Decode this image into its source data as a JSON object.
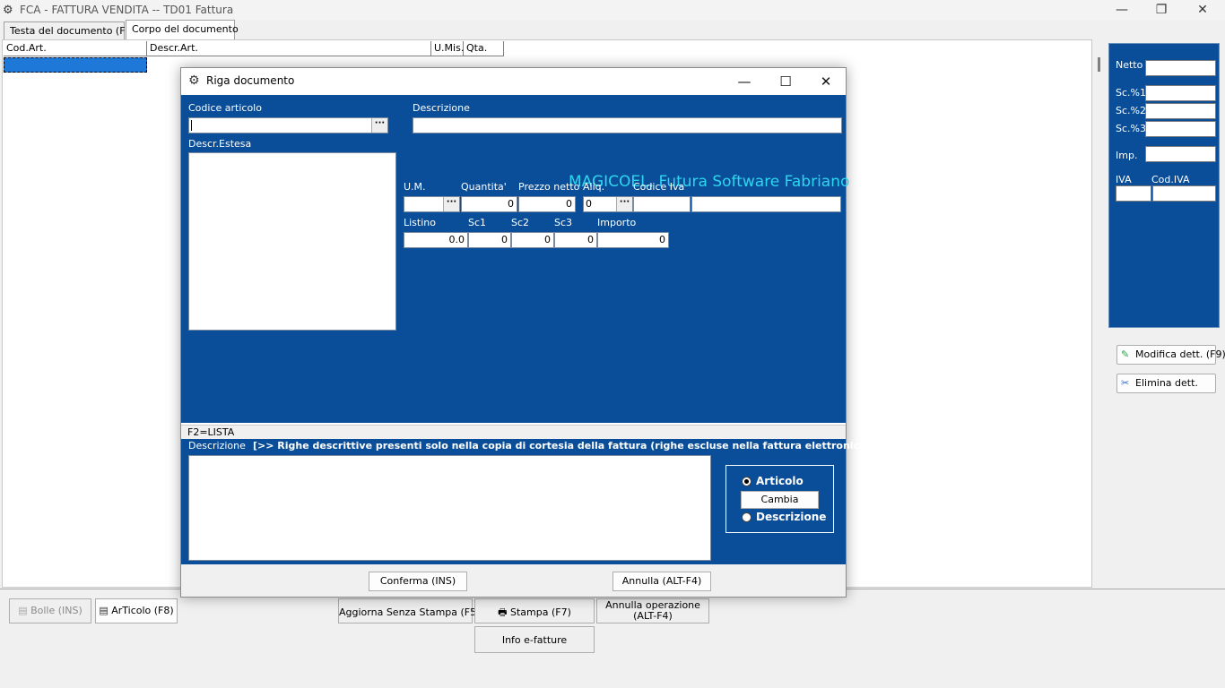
{
  "window": {
    "title": "FCA - FATTURA VENDITA  --  TD01 Fattura",
    "minimize": "—",
    "restore": "❐",
    "close": "✕"
  },
  "tabs": [
    {
      "label": "Testa del documento (F6)"
    },
    {
      "label": "Corpo del documento"
    }
  ],
  "grid": {
    "columns": [
      "Cod.Art.",
      "Descr.Art.",
      "U.Mis.",
      "Qta."
    ]
  },
  "right_panel": {
    "netto": "Netto",
    "sc1": "Sc.%1",
    "sc2": "Sc.%2",
    "sc3": "Sc.%3",
    "imp": "Imp.",
    "iva": "IVA",
    "cod_iva": "Cod.IVA",
    "modifica_btn": "Modifica dett. (F9)",
    "elimina_btn": "Elimina dett."
  },
  "bottom_bar": {
    "bolle": "Bolle  (INS)",
    "articolo": "ArTicolo (F8)",
    "aggiorna": "Aggiorna Senza Stampa (F5)",
    "stampa": "Stampa  (F7)",
    "annulla_op_line1": "Annulla operazione",
    "annulla_op_line2": "(ALT-F4)",
    "info": "Info e-fatture"
  },
  "dialog": {
    "title": "Riga documento",
    "minimize": "—",
    "maximize": "☐",
    "close": "✕",
    "codice_articolo_label": "Codice articolo",
    "descrizione_label": "Descrizione",
    "descr_estesa_label": "Descr.Estesa",
    "brand": "MAGICOEL, Futura Software Fabriano",
    "um_label": "U.M.",
    "quantita_label": "Quantita'",
    "prezzo_label": "Prezzo netto",
    "aliq_label": "Aliq.",
    "codice_iva_label": "Codice Iva",
    "quantita_value": "0",
    "prezzo_value": "0",
    "aliq_value": "0",
    "listino_label": "Listino",
    "sc1_label": "Sc1",
    "sc2_label": "Sc2",
    "sc3_label": "Sc3",
    "importo_label": "Importo",
    "listino_value": "0.0",
    "sc1_value": "0",
    "sc2_value": "0",
    "sc3_value": "0",
    "importo_value": "0",
    "dots": "···",
    "f2": "F2=LISTA",
    "lower_desc_label": "Descrizione",
    "note": "[>> Righe descrittive presenti solo nella copia di cortesia della fattura (righe escluse nella fattura elettronica) <<]",
    "radio_articolo": "Articolo",
    "cambia": "Cambia",
    "radio_descrizione": "Descrizione",
    "conferma": "Conferma  (INS)",
    "annulla": "Annulla  (ALT-F4)"
  },
  "colors": {
    "dialog_blue": "#0a4e99",
    "brand_cyan": "#2dd6ee",
    "selection_blue": "#1e78d7"
  }
}
